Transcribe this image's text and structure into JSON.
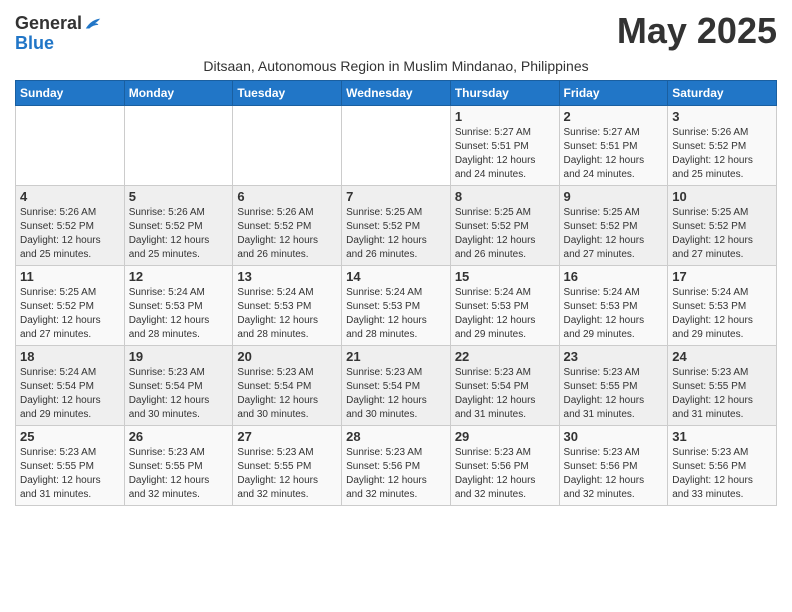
{
  "logo": {
    "general": "General",
    "blue": "Blue"
  },
  "title": "May 2025",
  "subtitle": "Ditsaan, Autonomous Region in Muslim Mindanao, Philippines",
  "days_of_week": [
    "Sunday",
    "Monday",
    "Tuesday",
    "Wednesday",
    "Thursday",
    "Friday",
    "Saturday"
  ],
  "weeks": [
    [
      {
        "day": "",
        "info": ""
      },
      {
        "day": "",
        "info": ""
      },
      {
        "day": "",
        "info": ""
      },
      {
        "day": "",
        "info": ""
      },
      {
        "day": "1",
        "info": "Sunrise: 5:27 AM\nSunset: 5:51 PM\nDaylight: 12 hours\nand 24 minutes."
      },
      {
        "day": "2",
        "info": "Sunrise: 5:27 AM\nSunset: 5:51 PM\nDaylight: 12 hours\nand 24 minutes."
      },
      {
        "day": "3",
        "info": "Sunrise: 5:26 AM\nSunset: 5:52 PM\nDaylight: 12 hours\nand 25 minutes."
      }
    ],
    [
      {
        "day": "4",
        "info": "Sunrise: 5:26 AM\nSunset: 5:52 PM\nDaylight: 12 hours\nand 25 minutes."
      },
      {
        "day": "5",
        "info": "Sunrise: 5:26 AM\nSunset: 5:52 PM\nDaylight: 12 hours\nand 25 minutes."
      },
      {
        "day": "6",
        "info": "Sunrise: 5:26 AM\nSunset: 5:52 PM\nDaylight: 12 hours\nand 26 minutes."
      },
      {
        "day": "7",
        "info": "Sunrise: 5:25 AM\nSunset: 5:52 PM\nDaylight: 12 hours\nand 26 minutes."
      },
      {
        "day": "8",
        "info": "Sunrise: 5:25 AM\nSunset: 5:52 PM\nDaylight: 12 hours\nand 26 minutes."
      },
      {
        "day": "9",
        "info": "Sunrise: 5:25 AM\nSunset: 5:52 PM\nDaylight: 12 hours\nand 27 minutes."
      },
      {
        "day": "10",
        "info": "Sunrise: 5:25 AM\nSunset: 5:52 PM\nDaylight: 12 hours\nand 27 minutes."
      }
    ],
    [
      {
        "day": "11",
        "info": "Sunrise: 5:25 AM\nSunset: 5:52 PM\nDaylight: 12 hours\nand 27 minutes."
      },
      {
        "day": "12",
        "info": "Sunrise: 5:24 AM\nSunset: 5:53 PM\nDaylight: 12 hours\nand 28 minutes."
      },
      {
        "day": "13",
        "info": "Sunrise: 5:24 AM\nSunset: 5:53 PM\nDaylight: 12 hours\nand 28 minutes."
      },
      {
        "day": "14",
        "info": "Sunrise: 5:24 AM\nSunset: 5:53 PM\nDaylight: 12 hours\nand 28 minutes."
      },
      {
        "day": "15",
        "info": "Sunrise: 5:24 AM\nSunset: 5:53 PM\nDaylight: 12 hours\nand 29 minutes."
      },
      {
        "day": "16",
        "info": "Sunrise: 5:24 AM\nSunset: 5:53 PM\nDaylight: 12 hours\nand 29 minutes."
      },
      {
        "day": "17",
        "info": "Sunrise: 5:24 AM\nSunset: 5:53 PM\nDaylight: 12 hours\nand 29 minutes."
      }
    ],
    [
      {
        "day": "18",
        "info": "Sunrise: 5:24 AM\nSunset: 5:54 PM\nDaylight: 12 hours\nand 29 minutes."
      },
      {
        "day": "19",
        "info": "Sunrise: 5:23 AM\nSunset: 5:54 PM\nDaylight: 12 hours\nand 30 minutes."
      },
      {
        "day": "20",
        "info": "Sunrise: 5:23 AM\nSunset: 5:54 PM\nDaylight: 12 hours\nand 30 minutes."
      },
      {
        "day": "21",
        "info": "Sunrise: 5:23 AM\nSunset: 5:54 PM\nDaylight: 12 hours\nand 30 minutes."
      },
      {
        "day": "22",
        "info": "Sunrise: 5:23 AM\nSunset: 5:54 PM\nDaylight: 12 hours\nand 31 minutes."
      },
      {
        "day": "23",
        "info": "Sunrise: 5:23 AM\nSunset: 5:55 PM\nDaylight: 12 hours\nand 31 minutes."
      },
      {
        "day": "24",
        "info": "Sunrise: 5:23 AM\nSunset: 5:55 PM\nDaylight: 12 hours\nand 31 minutes."
      }
    ],
    [
      {
        "day": "25",
        "info": "Sunrise: 5:23 AM\nSunset: 5:55 PM\nDaylight: 12 hours\nand 31 minutes."
      },
      {
        "day": "26",
        "info": "Sunrise: 5:23 AM\nSunset: 5:55 PM\nDaylight: 12 hours\nand 32 minutes."
      },
      {
        "day": "27",
        "info": "Sunrise: 5:23 AM\nSunset: 5:55 PM\nDaylight: 12 hours\nand 32 minutes."
      },
      {
        "day": "28",
        "info": "Sunrise: 5:23 AM\nSunset: 5:56 PM\nDaylight: 12 hours\nand 32 minutes."
      },
      {
        "day": "29",
        "info": "Sunrise: 5:23 AM\nSunset: 5:56 PM\nDaylight: 12 hours\nand 32 minutes."
      },
      {
        "day": "30",
        "info": "Sunrise: 5:23 AM\nSunset: 5:56 PM\nDaylight: 12 hours\nand 32 minutes."
      },
      {
        "day": "31",
        "info": "Sunrise: 5:23 AM\nSunset: 5:56 PM\nDaylight: 12 hours\nand 33 minutes."
      }
    ]
  ]
}
